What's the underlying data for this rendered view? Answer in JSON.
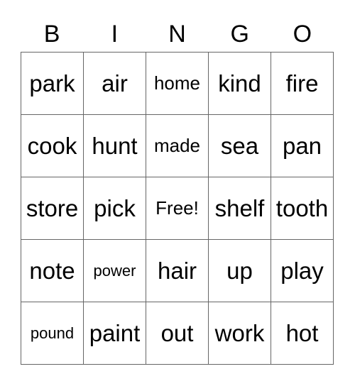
{
  "header": [
    "B",
    "I",
    "N",
    "G",
    "O"
  ],
  "cells": [
    {
      "text": "park",
      "size": "lg"
    },
    {
      "text": "air",
      "size": "lg"
    },
    {
      "text": "home",
      "size": "sm"
    },
    {
      "text": "kind",
      "size": "lg"
    },
    {
      "text": "fire",
      "size": "lg"
    },
    {
      "text": "cook",
      "size": "lg"
    },
    {
      "text": "hunt",
      "size": "lg"
    },
    {
      "text": "made",
      "size": "sm"
    },
    {
      "text": "sea",
      "size": "lg"
    },
    {
      "text": "pan",
      "size": "lg"
    },
    {
      "text": "store",
      "size": "lg"
    },
    {
      "text": "pick",
      "size": "lg"
    },
    {
      "text": "Free!",
      "size": "sm"
    },
    {
      "text": "shelf",
      "size": "lg"
    },
    {
      "text": "tooth",
      "size": "lg"
    },
    {
      "text": "note",
      "size": "lg"
    },
    {
      "text": "power",
      "size": "xs"
    },
    {
      "text": "hair",
      "size": "lg"
    },
    {
      "text": "up",
      "size": "lg"
    },
    {
      "text": "play",
      "size": "lg"
    },
    {
      "text": "pound",
      "size": "xs"
    },
    {
      "text": "paint",
      "size": "lg"
    },
    {
      "text": "out",
      "size": "lg"
    },
    {
      "text": "work",
      "size": "lg"
    },
    {
      "text": "hot",
      "size": "lg"
    }
  ],
  "colors": {
    "grid_line": "#666666",
    "text": "#000000",
    "background": "#ffffff"
  }
}
